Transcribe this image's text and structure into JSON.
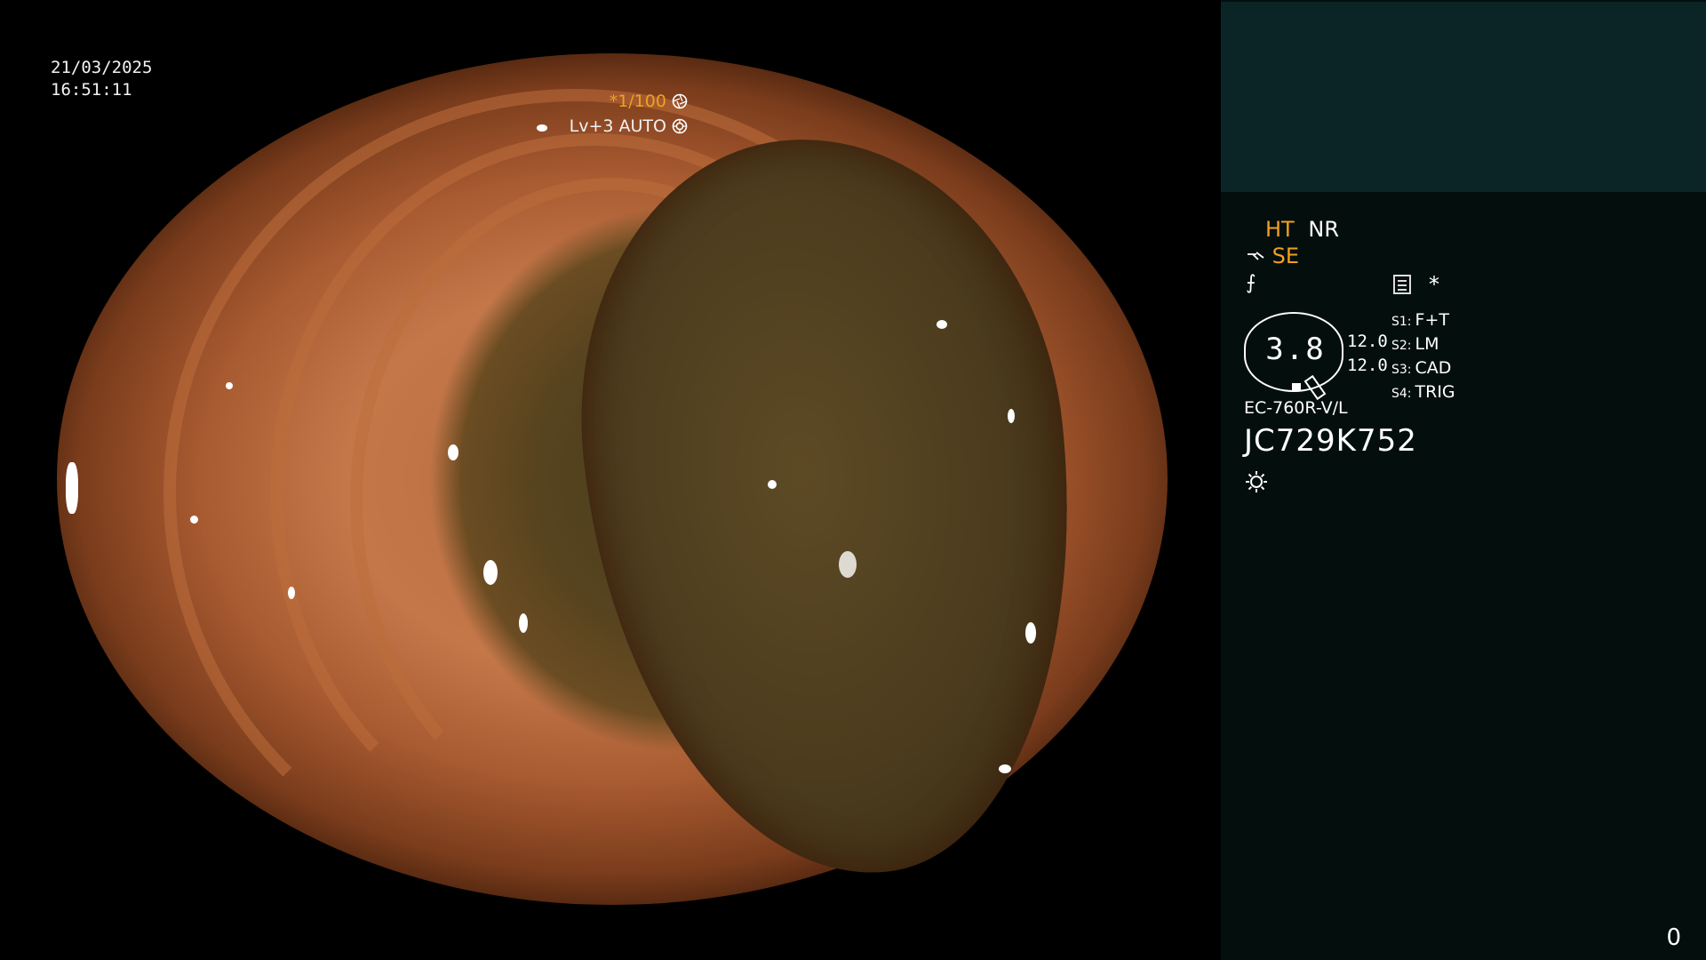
{
  "overlay": {
    "date": "21/03/2025",
    "time": "16:51:11",
    "shutter": "*1/100",
    "shutter_icon": "aperture-icon",
    "level": "Lv+3 AUTO",
    "level_icon": "iris-icon"
  },
  "panel": {
    "mode_ht": "HT",
    "mode_nr": "NR",
    "se_label": "SE",
    "se_icon": "scope-tip-icon",
    "f_icon_glyph": "⨍",
    "doc_icon": "memo-icon",
    "star_glyph": "*",
    "gauge_value": "3.8",
    "upper_value": "12.0",
    "lower_value": "12.0",
    "switches": [
      {
        "key": "S1:",
        "value": "F+T"
      },
      {
        "key": "S2:",
        "value": "LM"
      },
      {
        "key": "S3:",
        "value": "CAD"
      },
      {
        "key": "S4:",
        "value": "TRIG"
      }
    ],
    "scope_model": "EC-760R-V/L",
    "serial_number": "JC729K752",
    "light_icon": "sun-icon",
    "counter": "0"
  },
  "colors": {
    "accent_orange": "#f0a020",
    "panel_bg": "#040f0d",
    "panel_top_bg": "#0b2527"
  }
}
